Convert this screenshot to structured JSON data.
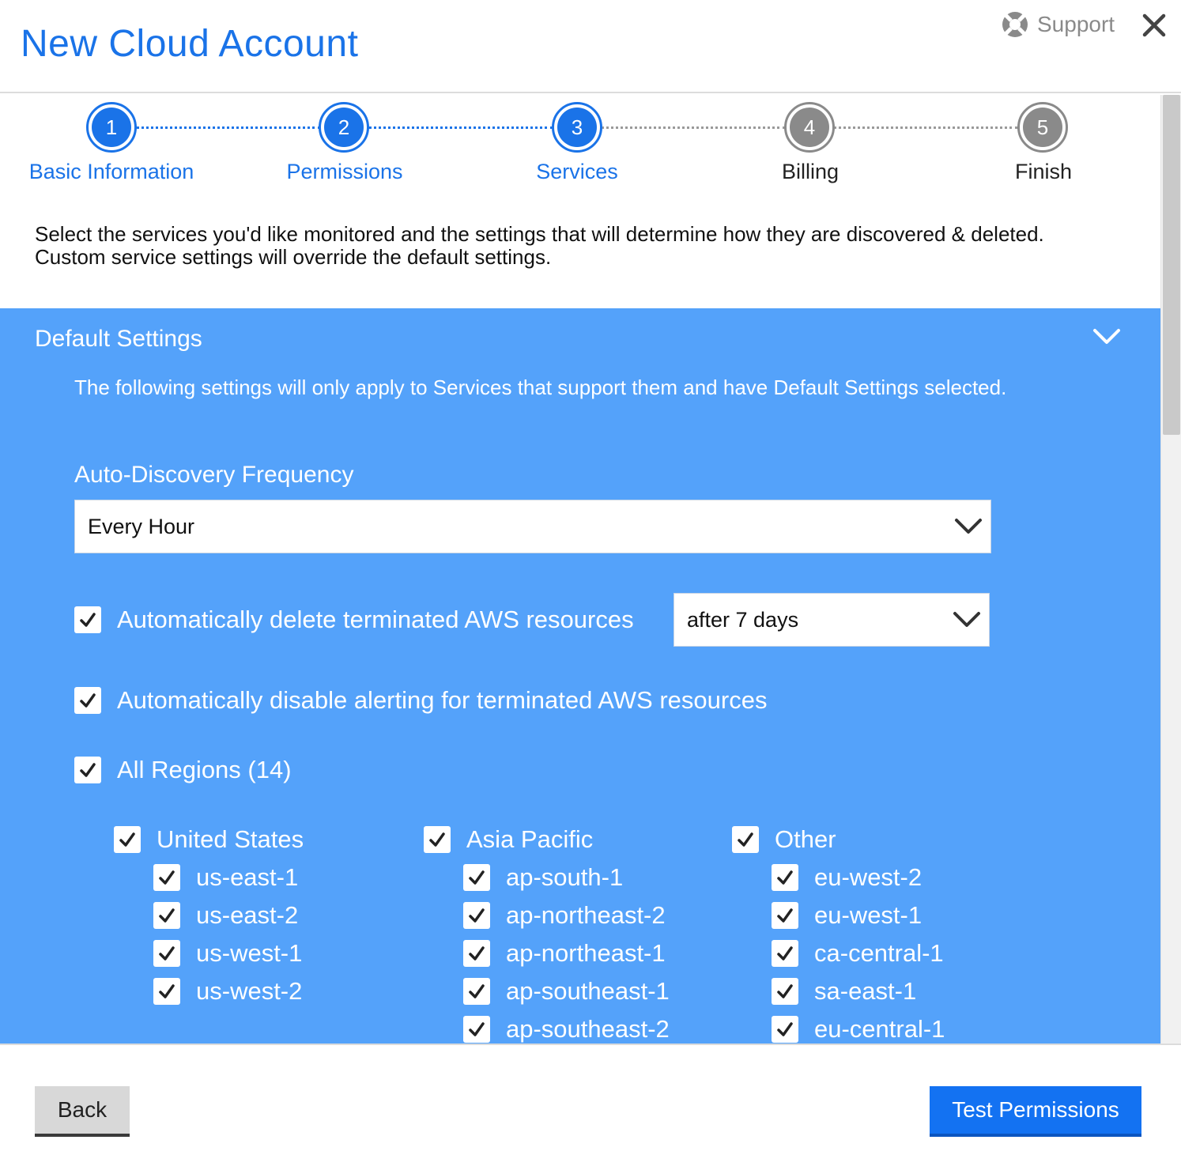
{
  "header": {
    "title": "New Cloud Account",
    "support_label": "Support"
  },
  "steps": [
    {
      "number": "1",
      "label": "Basic Information",
      "state": "complete"
    },
    {
      "number": "2",
      "label": "Permissions",
      "state": "complete"
    },
    {
      "number": "3",
      "label": "Services",
      "state": "current"
    },
    {
      "number": "4",
      "label": "Billing",
      "state": "pending"
    },
    {
      "number": "5",
      "label": "Finish",
      "state": "pending"
    }
  ],
  "intro_text": "Select the services you'd like monitored and the settings that will determine how they are discovered & deleted. Custom service settings will override the default settings.",
  "default_settings": {
    "title": "Default Settings",
    "description": "The following settings will only apply to Services that support them and have Default Settings selected.",
    "auto_discovery_label": "Auto-Discovery Frequency",
    "auto_discovery_value": "Every Hour",
    "delete_terminated": {
      "label": "Automatically delete terminated AWS resources",
      "checked": true,
      "value": "after 7 days"
    },
    "disable_alerting": {
      "label": "Automatically disable alerting for terminated AWS resources",
      "checked": true
    },
    "all_regions": {
      "label": "All Regions (14)",
      "checked": true
    },
    "region_groups": [
      {
        "label": "United States",
        "checked": true,
        "regions": [
          "us-east-1",
          "us-east-2",
          "us-west-1",
          "us-west-2"
        ]
      },
      {
        "label": "Asia Pacific",
        "checked": true,
        "regions": [
          "ap-south-1",
          "ap-northeast-2",
          "ap-northeast-1",
          "ap-southeast-1",
          "ap-southeast-2"
        ]
      },
      {
        "label": "Other",
        "checked": true,
        "regions": [
          "eu-west-2",
          "eu-west-1",
          "ca-central-1",
          "sa-east-1",
          "eu-central-1"
        ]
      }
    ]
  },
  "footer": {
    "back_label": "Back",
    "test_label": "Test Permissions"
  },
  "colors": {
    "accent": "#1a73e8",
    "panel_bg": "#54a2fa",
    "pending_step": "#8a8a8a",
    "primary_button": "#1372f2"
  },
  "icons": {
    "support": "lifebuoy-icon",
    "close": "close-icon",
    "collapse": "chevron-down-icon",
    "check": "checkmark-icon"
  }
}
